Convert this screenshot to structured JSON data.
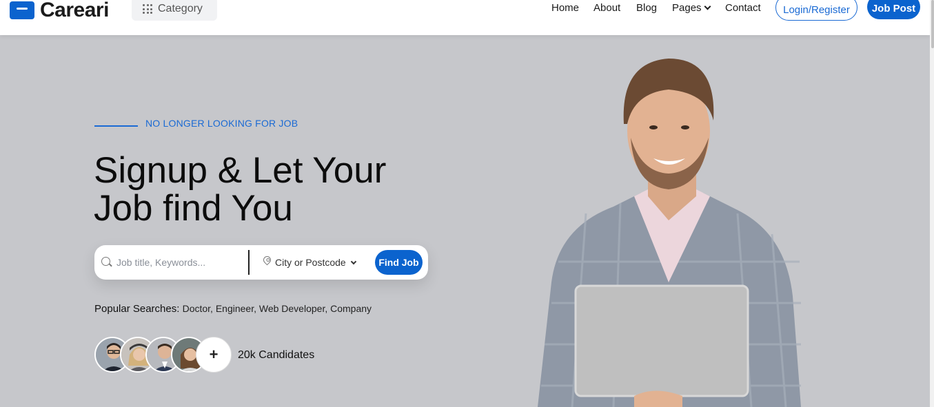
{
  "header": {
    "brand": "Careari",
    "category_label": "Category",
    "nav": [
      "Home",
      "About",
      "Blog",
      "Pages",
      "Contact"
    ],
    "login_label": "Login/Register",
    "post_label": "Job Post"
  },
  "hero": {
    "tagline": "NO LONGER LOOKING FOR JOB",
    "title_line1": "Signup & Let Your",
    "title_line2": "Job find You"
  },
  "search": {
    "placeholder": "Job title, Keywords...",
    "location_value": "City or Postcode",
    "button": "Find Job"
  },
  "popular": {
    "label": "Popular Searches:",
    "terms": "Doctor, Engineer, Web Developer, Company"
  },
  "candidates": {
    "plus": "+",
    "count_label": "20k Candidates"
  },
  "colors": {
    "accent": "#0b63ce",
    "hero_bg": "#c6c7cb"
  }
}
